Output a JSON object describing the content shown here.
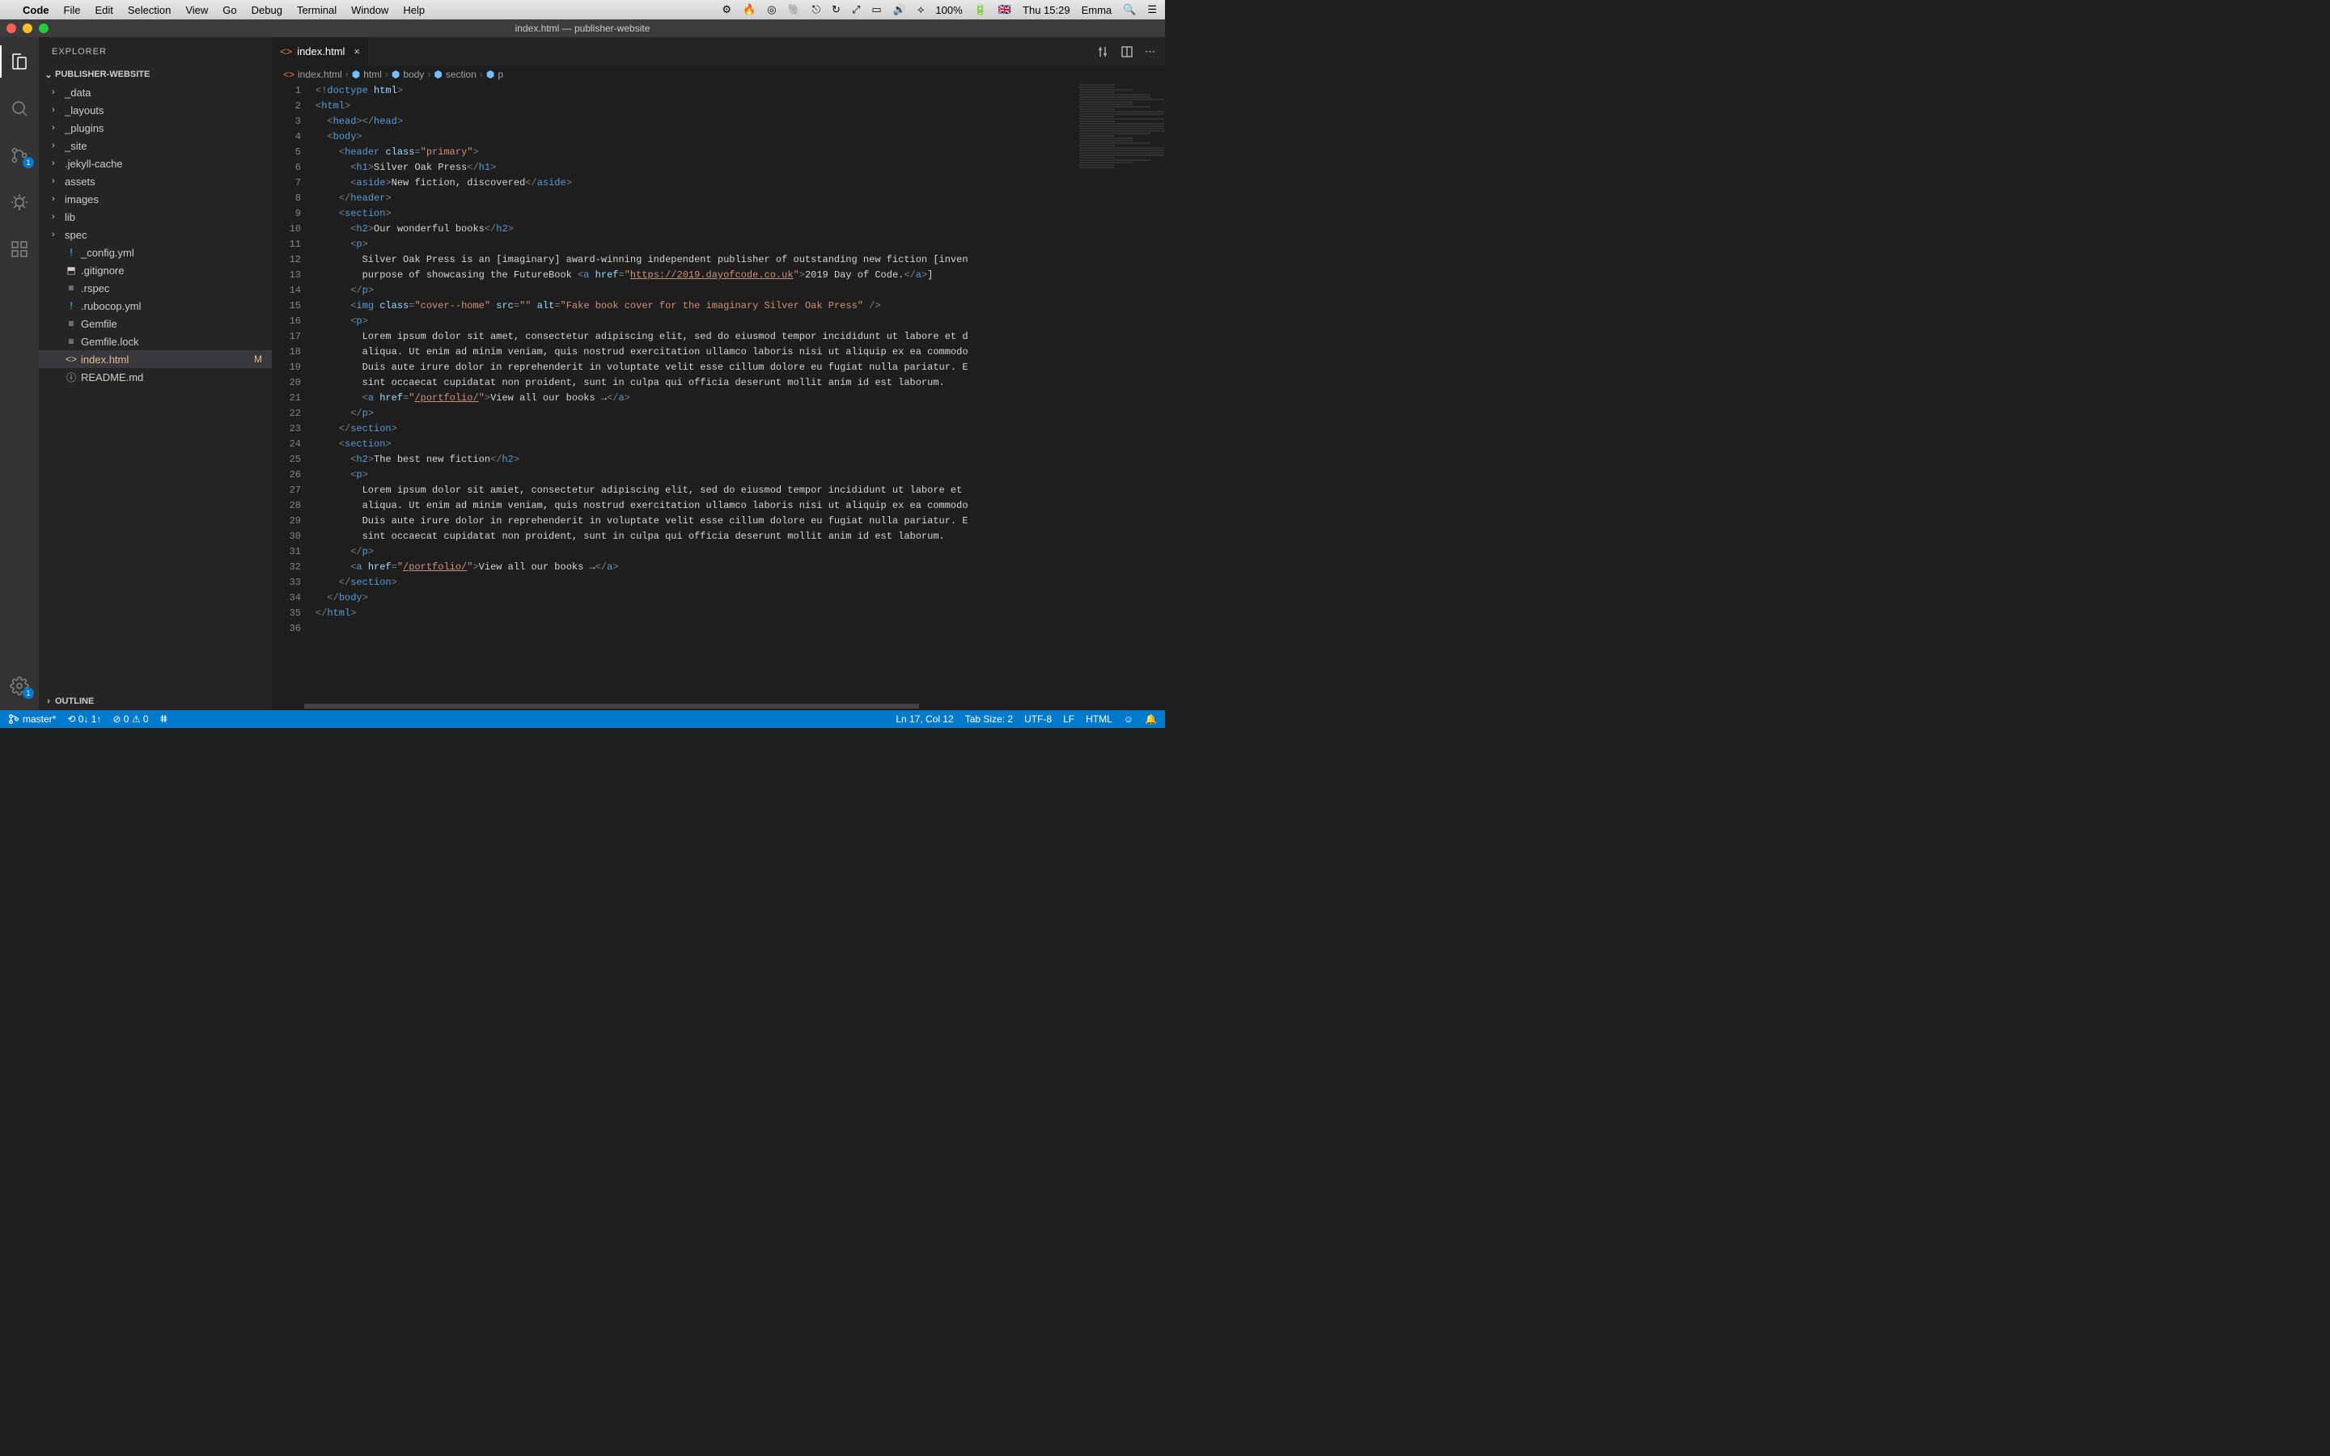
{
  "macos": {
    "app": "Code",
    "menus": [
      "File",
      "Edit",
      "Selection",
      "View",
      "Go",
      "Debug",
      "Terminal",
      "Window",
      "Help"
    ],
    "battery": "100%",
    "clock": "Thu 15:29",
    "user": "Emma"
  },
  "window": {
    "title": "index.html — publisher-website"
  },
  "activity": {
    "scm_badge": "1",
    "settings_badge": "1"
  },
  "sidebar": {
    "title": "EXPLORER",
    "project": "PUBLISHER-WEBSITE",
    "outline": "OUTLINE",
    "tree": [
      {
        "type": "folder",
        "name": "_data"
      },
      {
        "type": "folder",
        "name": "_layouts"
      },
      {
        "type": "folder",
        "name": "_plugins"
      },
      {
        "type": "folder",
        "name": "_site"
      },
      {
        "type": "folder",
        "name": ".jekyll-cache"
      },
      {
        "type": "folder",
        "name": "assets"
      },
      {
        "type": "folder",
        "name": "images"
      },
      {
        "type": "folder",
        "name": "lib"
      },
      {
        "type": "folder",
        "name": "spec"
      },
      {
        "type": "file",
        "name": "_config.yml",
        "icon": "!",
        "iconClass": "icon-warn"
      },
      {
        "type": "file",
        "name": ".gitignore",
        "icon": "⬒"
      },
      {
        "type": "file",
        "name": ".rspec",
        "icon": "≡"
      },
      {
        "type": "file",
        "name": ".rubocop.yml",
        "icon": "!",
        "iconClass": "icon-warn"
      },
      {
        "type": "file",
        "name": "Gemfile",
        "icon": "≡"
      },
      {
        "type": "file",
        "name": "Gemfile.lock",
        "icon": "≡"
      },
      {
        "type": "file",
        "name": "index.html",
        "icon": "<>",
        "selected": true,
        "modified": true,
        "status": "M"
      },
      {
        "type": "file",
        "name": "README.md",
        "icon": "ⓘ"
      }
    ]
  },
  "tabs": {
    "open": [
      {
        "name": "index.html"
      }
    ]
  },
  "breadcrumbs": [
    "index.html",
    "html",
    "body",
    "section",
    "p"
  ],
  "statusbar": {
    "branch": "master*",
    "sync": "⟲ 0↓ 1↑",
    "problems": "⊘ 0 ⚠ 0",
    "cursor": "Ln 17, Col 12",
    "tab": "Tab Size: 2",
    "encoding": "UTF-8",
    "eol": "LF",
    "lang": "HTML"
  },
  "code_lines": [
    {
      "n": 1,
      "html": "<span class='t-punct'>&lt;!</span><span class='t-tag'>doctype</span> <span class='t-attr'>html</span><span class='t-punct'>&gt;</span>"
    },
    {
      "n": 2,
      "html": "<span class='t-punct'>&lt;</span><span class='t-tag'>html</span><span class='t-punct'>&gt;</span>"
    },
    {
      "n": 3,
      "html": "  <span class='t-punct'>&lt;</span><span class='t-tag'>head</span><span class='t-punct'>&gt;&lt;/</span><span class='t-tag'>head</span><span class='t-punct'>&gt;</span>"
    },
    {
      "n": 4,
      "html": "  <span class='t-punct'>&lt;</span><span class='t-tag'>body</span><span class='t-punct'>&gt;</span>"
    },
    {
      "n": 5,
      "html": "    <span class='t-punct'>&lt;</span><span class='t-tag'>header</span> <span class='t-attr'>class</span><span class='t-punct'>=</span><span class='t-str'>\"primary\"</span><span class='t-punct'>&gt;</span>",
      "diff": true
    },
    {
      "n": 6,
      "html": "      <span class='t-punct'>&lt;</span><span class='t-tag'>h1</span><span class='t-punct'>&gt;</span><span class='t-text'>Silver Oak Press</span><span class='t-punct'>&lt;/</span><span class='t-tag'>h1</span><span class='t-punct'>&gt;</span>",
      "diff": true
    },
    {
      "n": 7,
      "html": "      <span class='t-punct'>&lt;</span><span class='t-tag'>aside</span><span class='t-punct'>&gt;</span><span class='t-text'>New fiction, discovered</span><span class='t-punct'>&lt;/</span><span class='t-tag'>aside</span><span class='t-punct'>&gt;</span>",
      "diff": true
    },
    {
      "n": 8,
      "html": "    <span class='t-punct'>&lt;/</span><span class='t-tag'>header</span><span class='t-punct'>&gt;</span>",
      "diff": true
    },
    {
      "n": 9,
      "html": "    <span class='t-punct'>&lt;</span><span class='t-tag'>section</span><span class='t-punct'>&gt;</span>",
      "diff": true
    },
    {
      "n": 10,
      "html": "      <span class='t-punct'>&lt;</span><span class='t-tag'>h2</span><span class='t-punct'>&gt;</span><span class='t-text'>Our wonderful books</span><span class='t-punct'>&lt;/</span><span class='t-tag'>h2</span><span class='t-punct'>&gt;</span>",
      "diff": true
    },
    {
      "n": 11,
      "html": "      <span class='t-punct'>&lt;</span><span class='t-tag'>p</span><span class='t-punct'>&gt;</span>",
      "diff": true
    },
    {
      "n": 12,
      "html": "        <span class='t-text'>Silver Oak Press is an [imaginary] award-winning independent publisher of outstanding new fiction [inven</span>",
      "diff": true
    },
    {
      "n": 13,
      "html": "        <span class='t-text'>purpose of showcasing the FutureBook </span><span class='t-punct'>&lt;</span><span class='t-tag'>a</span> <span class='t-attr'>href</span><span class='t-punct'>=</span><span class='t-str'>\"</span><span class='t-link'>https://2019.dayofcode.co.uk</span><span class='t-str'>\"</span><span class='t-punct'>&gt;</span><span class='t-text'>2019 Day of Code.</span><span class='t-punct'>&lt;/</span><span class='t-tag'>a</span><span class='t-punct'>&gt;</span><span class='t-text'>]</span>",
      "diff": true
    },
    {
      "n": 14,
      "html": "      <span class='t-punct'>&lt;/</span><span class='t-tag'>p</span><span class='t-punct'>&gt;</span>",
      "diff": true
    },
    {
      "n": 15,
      "html": "      <span class='t-punct'>&lt;</span><span class='t-tag'>img</span> <span class='t-attr'>class</span><span class='t-punct'>=</span><span class='t-str'>\"cover--home\"</span> <span class='t-attr'>src</span><span class='t-punct'>=</span><span class='t-str'>\"\"</span> <span class='t-attr'>alt</span><span class='t-punct'>=</span><span class='t-str'>\"Fake book cover for the imaginary Silver Oak Press\"</span> <span class='t-punct'>/&gt;</span>",
      "diff": true
    },
    {
      "n": 16,
      "html": "      <span class='t-punct'>&lt;</span><span class='t-tag'>p</span><span class='t-punct'>&gt;</span>",
      "diff": true
    },
    {
      "n": 17,
      "html": "        <span class='t-text'>Lorem ipsum dolor sit amet, consectetur adipiscing elit, sed do eiusmod tempor incididunt ut labore et d</span>",
      "diff": true
    },
    {
      "n": 18,
      "html": "        <span class='t-text'>aliqua. Ut enim ad minim veniam, quis nostrud exercitation ullamco laboris nisi ut aliquip ex ea commodo</span>",
      "diff": true
    },
    {
      "n": 19,
      "html": "        <span class='t-text'>Duis aute irure dolor in reprehenderit in voluptate velit esse cillum dolore eu fugiat nulla pariatur. E</span>",
      "diff": true
    },
    {
      "n": 20,
      "html": "        <span class='t-text'>sint occaecat cupidatat non proident, sunt in culpa qui officia deserunt mollit anim id est laborum.</span>",
      "diff": true
    },
    {
      "n": 21,
      "html": "        <span class='t-punct'>&lt;</span><span class='t-tag'>a</span> <span class='t-attr'>href</span><span class='t-punct'>=</span><span class='t-str'>\"</span><span class='t-link'>/portfolio/</span><span class='t-str'>\"</span><span class='t-punct'>&gt;</span><span class='t-text'>View all our books →</span><span class='t-punct'>&lt;/</span><span class='t-tag'>a</span><span class='t-punct'>&gt;</span>",
      "diff": true
    },
    {
      "n": 22,
      "html": "      <span class='t-punct'>&lt;/</span><span class='t-tag'>p</span><span class='t-punct'>&gt;</span>",
      "diff": true
    },
    {
      "n": 23,
      "html": "    <span class='t-punct'>&lt;/</span><span class='t-tag'>section</span><span class='t-punct'>&gt;</span>",
      "diff": true
    },
    {
      "n": 24,
      "html": "    <span class='t-punct'>&lt;</span><span class='t-tag'>section</span><span class='t-punct'>&gt;</span>",
      "diff": true
    },
    {
      "n": 25,
      "html": "      <span class='t-punct'>&lt;</span><span class='t-tag'>h2</span><span class='t-punct'>&gt;</span><span class='t-text'>The best new fiction</span><span class='t-punct'>&lt;/</span><span class='t-tag'>h2</span><span class='t-punct'>&gt;</span>",
      "diff": true
    },
    {
      "n": 26,
      "html": "      <span class='t-punct'>&lt;</span><span class='t-tag'>p</span><span class='t-punct'>&gt;</span>",
      "diff": true
    },
    {
      "n": 27,
      "html": "        <span class='t-text'>Lorem ipsum dolor sit amiet, consectetur adipiscing elit, sed do eiusmod tempor incididunt ut labore et </span>",
      "diff": true
    },
    {
      "n": 28,
      "html": "        <span class='t-text'>aliqua. Ut enim ad minim veniam, quis nostrud exercitation ullamco laboris nisi ut aliquip ex ea commodo</span>",
      "diff": true
    },
    {
      "n": 29,
      "html": "        <span class='t-text'>Duis aute irure dolor in reprehenderit in voluptate velit esse cillum dolore eu fugiat nulla pariatur. E</span>",
      "diff": true
    },
    {
      "n": 30,
      "html": "        <span class='t-text'>sint occaecat cupidatat non proident, sunt in culpa qui officia deserunt mollit anim id est laborum.</span>",
      "diff": true
    },
    {
      "n": 31,
      "html": "      <span class='t-punct'>&lt;/</span><span class='t-tag'>p</span><span class='t-punct'>&gt;</span>",
      "diff": true
    },
    {
      "n": 32,
      "html": "      <span class='t-punct'>&lt;</span><span class='t-tag'>a</span> <span class='t-attr'>href</span><span class='t-punct'>=</span><span class='t-str'>\"</span><span class='t-link'>/portfolio/</span><span class='t-str'>\"</span><span class='t-punct'>&gt;</span><span class='t-text'>View all our books →</span><span class='t-punct'>&lt;/</span><span class='t-tag'>a</span><span class='t-punct'>&gt;</span>",
      "diff": true
    },
    {
      "n": 33,
      "html": "    <span class='t-punct'>&lt;/</span><span class='t-tag'>section</span><span class='t-punct'>&gt;</span>",
      "diff": true
    },
    {
      "n": 34,
      "html": "  <span class='t-punct'>&lt;/</span><span class='t-tag'>body</span><span class='t-punct'>&gt;</span>"
    },
    {
      "n": 35,
      "html": "<span class='t-punct'>&lt;/</span><span class='t-tag'>html</span><span class='t-punct'>&gt;</span>"
    },
    {
      "n": 36,
      "html": ""
    }
  ]
}
